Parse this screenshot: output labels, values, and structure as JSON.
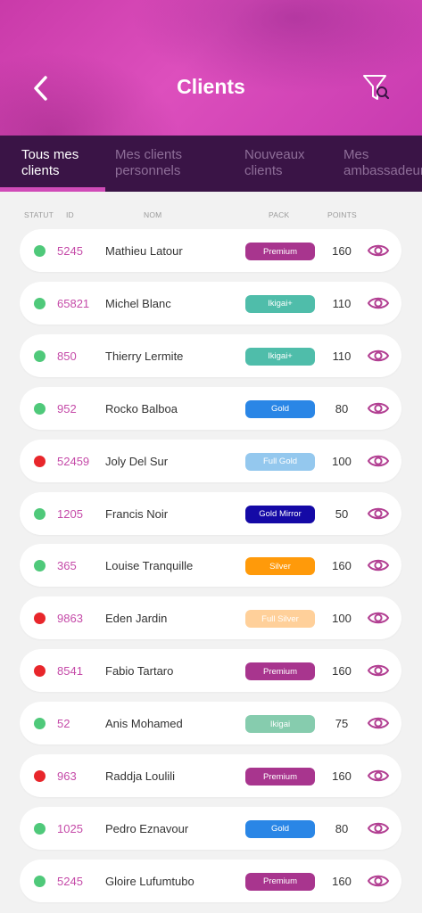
{
  "header": {
    "title": "Clients",
    "back_icon": "chevron-left-icon",
    "filter_icon": "filter-search-icon"
  },
  "tabs": [
    {
      "label": "Tous mes clients",
      "active": true
    },
    {
      "label": "Mes clients personnels",
      "active": false
    },
    {
      "label": "Nouveaux clients",
      "active": false
    },
    {
      "label": "Mes ambassadeurs",
      "active": false
    }
  ],
  "columns": {
    "status": "STATUT",
    "id": "ID",
    "name": "NOM",
    "pack": "PACK",
    "points": "POINTS"
  },
  "colors": {
    "status_active": "#4fc97a",
    "status_inactive": "#e8262b",
    "Premium": "#a8358e",
    "Ikigai+": "#4fbdaa",
    "Gold": "#2a86e6",
    "Full Gold": "#94c8ee",
    "Gold Mirror": "#1409a6",
    "Silver": "#ff9a0a",
    "Full Silver": "#ffd09a",
    "Ikigai": "#86ccae",
    "eye_icon": "#b23f92"
  },
  "clients": [
    {
      "status": "active",
      "id": "5245",
      "name": "Mathieu Latour",
      "pack": "Premium",
      "points": "160"
    },
    {
      "status": "active",
      "id": "65821",
      "name": "Michel Blanc",
      "pack": "Ikigai+",
      "points": "110"
    },
    {
      "status": "active",
      "id": "850",
      "name": "Thierry Lermite",
      "pack": "Ikigai+",
      "points": "110"
    },
    {
      "status": "active",
      "id": "952",
      "name": "Rocko Balboa",
      "pack": "Gold",
      "points": "80"
    },
    {
      "status": "inactive",
      "id": "52459",
      "name": "Joly Del Sur",
      "pack": "Full Gold",
      "points": "100"
    },
    {
      "status": "active",
      "id": "1205",
      "name": "Francis Noir",
      "pack": "Gold Mirror",
      "points": "50"
    },
    {
      "status": "active",
      "id": "365",
      "name": "Louise Tranquille",
      "pack": "Silver",
      "points": "160"
    },
    {
      "status": "inactive",
      "id": "9863",
      "name": "Eden Jardin",
      "pack": "Full Silver",
      "points": "100"
    },
    {
      "status": "inactive",
      "id": "8541",
      "name": "Fabio Tartaro",
      "pack": "Premium",
      "points": "160"
    },
    {
      "status": "active",
      "id": "52",
      "name": "Anis Mohamed",
      "pack": "Ikigai",
      "points": "75"
    },
    {
      "status": "inactive",
      "id": "963",
      "name": "Raddja Loulili",
      "pack": "Premium",
      "points": "160"
    },
    {
      "status": "active",
      "id": "1025",
      "name": "Pedro Eznavour",
      "pack": "Gold",
      "points": "80"
    },
    {
      "status": "active",
      "id": "5245",
      "name": "Gloire Lufumtubo",
      "pack": "Premium",
      "points": "160"
    }
  ]
}
